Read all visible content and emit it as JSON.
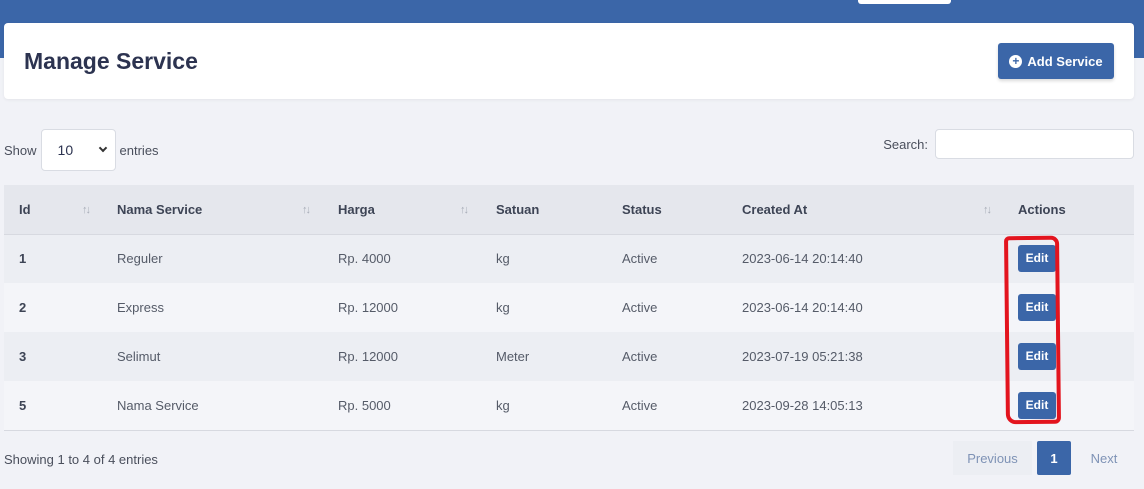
{
  "page": {
    "title": "Manage Service",
    "add_button": "Add Service"
  },
  "controls": {
    "show_label": "Show",
    "entries_value": "10",
    "entries_label": "entries",
    "search_label": "Search:",
    "search_value": ""
  },
  "table": {
    "headers": {
      "id": "Id",
      "nama": "Nama Service",
      "harga": "Harga",
      "satuan": "Satuan",
      "status": "Status",
      "created": "Created At",
      "actions": "Actions"
    },
    "rows": [
      {
        "id": "1",
        "nama": "Reguler",
        "harga": "Rp. 4000",
        "satuan": "kg",
        "status": "Active",
        "created": "2023-06-14 20:14:40",
        "action": "Edit"
      },
      {
        "id": "2",
        "nama": "Express",
        "harga": "Rp. 12000",
        "satuan": "kg",
        "status": "Active",
        "created": "2023-06-14 20:14:40",
        "action": "Edit"
      },
      {
        "id": "3",
        "nama": "Selimut",
        "harga": "Rp. 12000",
        "satuan": "Meter",
        "status": "Active",
        "created": "2023-07-19 05:21:38",
        "action": "Edit"
      },
      {
        "id": "5",
        "nama": "Nama Service",
        "harga": "Rp. 5000",
        "satuan": "kg",
        "status": "Active",
        "created": "2023-09-28 14:05:13",
        "action": "Edit"
      }
    ]
  },
  "footer": {
    "info": "Showing 1 to 4 of 4 entries",
    "previous": "Previous",
    "current_page": "1",
    "next": "Next"
  },
  "colors": {
    "primary": "#3b66a8",
    "annotation": "#e3141e"
  }
}
